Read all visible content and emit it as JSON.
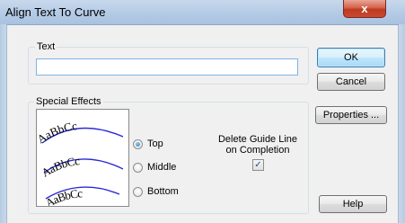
{
  "window": {
    "title": "Align Text To Curve",
    "close_glyph": "x"
  },
  "text_group": {
    "legend": "Text",
    "value": "",
    "placeholder": ""
  },
  "buttons": {
    "ok": "OK",
    "cancel": "Cancel",
    "properties": "Properties ...",
    "help": "Help"
  },
  "effects": {
    "legend": "Special Effects",
    "preview_sample": "AaBbCc",
    "options": [
      {
        "label": "Top",
        "selected": true
      },
      {
        "label": "Middle",
        "selected": false
      },
      {
        "label": "Bottom",
        "selected": false
      }
    ],
    "delete_guide_line": {
      "label_line1": "Delete Guide Line",
      "label_line2": "on Completion",
      "checked": true,
      "check_glyph": "✓"
    }
  },
  "colors": {
    "curve": "#2b2bd6",
    "accent": "#3c7fb1"
  }
}
